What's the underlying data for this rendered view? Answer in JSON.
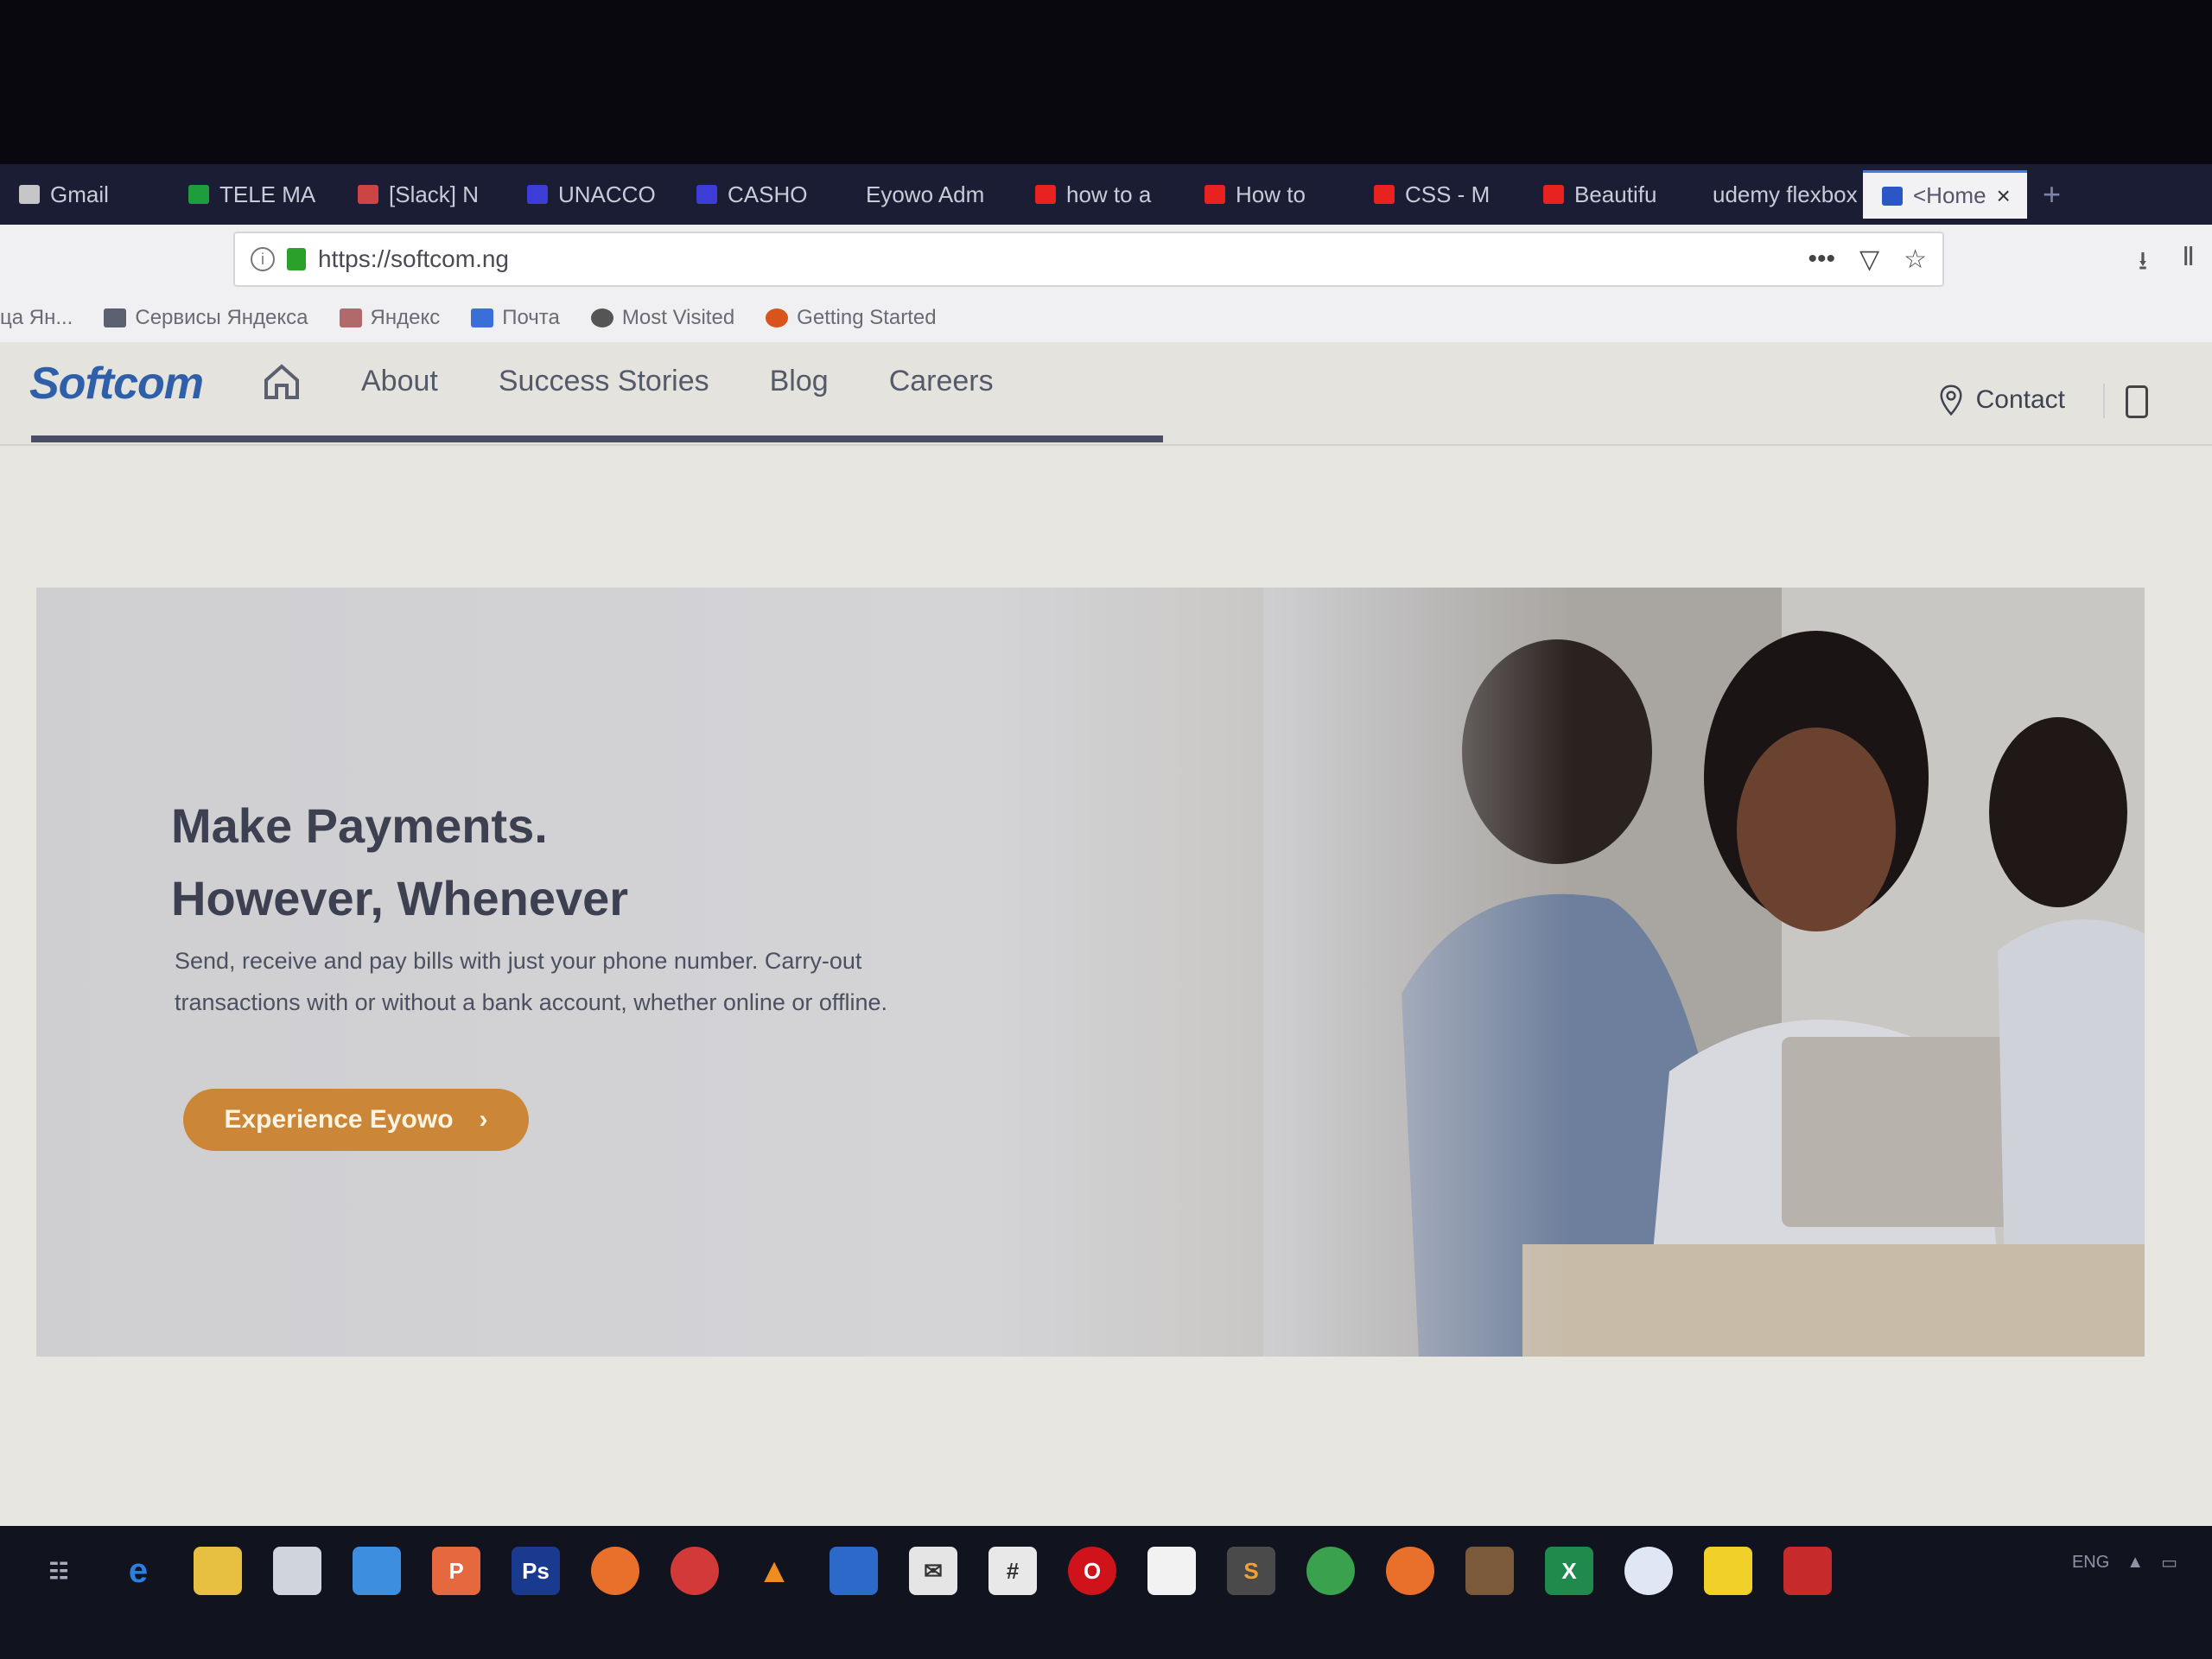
{
  "browser": {
    "tabs": [
      {
        "label": "Gmail",
        "color": "#c6c6c6"
      },
      {
        "label": "TELE MA",
        "color": "#1e9d3c"
      },
      {
        "label": "[Slack] N",
        "color": "#c44"
      },
      {
        "label": "UNACCO",
        "color": "#3c3cd6"
      },
      {
        "label": "CASHO",
        "color": "#3c3cd6"
      },
      {
        "label": "Eyowo Adm",
        "color": ""
      },
      {
        "label": "how to a",
        "color": "#e8231f"
      },
      {
        "label": "How to",
        "color": "#e8231f"
      },
      {
        "label": "CSS - M",
        "color": "#e8231f"
      },
      {
        "label": "Beautifu",
        "color": "#e8231f"
      },
      {
        "label": "udemy flexbox",
        "color": ""
      },
      {
        "label": "<Home",
        "color": "#2a56c6",
        "active": true
      }
    ],
    "new_tab": "+",
    "url": "https://softcom.ng",
    "bookmarks": [
      "ца Ян...",
      "Сервисы Яндекса",
      "Яндекс",
      "Почта",
      "Most Visited",
      "Getting Started"
    ]
  },
  "site": {
    "logo": "Softcom",
    "nav": [
      "About",
      "Success Stories",
      "Blog",
      "Careers"
    ],
    "contact": "Contact"
  },
  "hero": {
    "title_line1": "Make Payments.",
    "title_line2": "However, Whenever",
    "desc": "Send, receive and pay bills with just your phone number. Carry-out transactions with or without a bank account, whether online or offline.",
    "cta": "Experience Eyowo",
    "cta_arrow": "›"
  },
  "taskbar": {
    "apps": [
      "task-view",
      "edge",
      "file-explorer",
      "store",
      "mail-bird",
      "powerpoint",
      "photoshop",
      "firefox",
      "app-red",
      "vlc",
      "app-blue",
      "mail",
      "slack",
      "opera",
      "notepad",
      "sublime",
      "chrome",
      "firefox-2",
      "app-swirl",
      "excel",
      "skype",
      "sticky",
      "app-red-2"
    ],
    "tray_text": "ENG"
  }
}
